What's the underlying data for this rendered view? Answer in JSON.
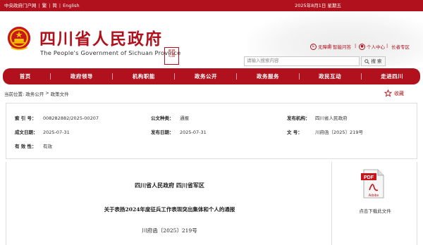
{
  "topbar": {
    "links": [
      "中央政府门户网",
      "繁",
      "简",
      "English"
    ],
    "date": "2025年8月1日 星期五"
  },
  "header": {
    "title": "四川省人民政府",
    "subtitle": "The People's Government of Sichuan Province",
    "seal_text": "天府之国",
    "quick_links": [
      "无障碍",
      "智能问答",
      "个人中心",
      "长者专区"
    ],
    "search_placeholder": "请输入搜索内容",
    "search_button": "搜 索"
  },
  "nav": [
    "首页",
    "政府领导",
    "机构职能",
    "政务公开",
    "政务服务",
    "政民互动",
    "走进四川"
  ],
  "breadcrumb": {
    "prefix": "当前位置:",
    "items": [
      "政务公开",
      "政策文件"
    ],
    "sep": ">"
  },
  "favorite": "收藏",
  "info": {
    "index_label": "索 引 号：",
    "index_value": "008282882/2025-00207",
    "type_label": "公文种类：",
    "type_value": "通报",
    "org_label": "发布机构：",
    "org_value": "四川省人民政府",
    "made_label": "成文日期：",
    "made_value": "2025-07-31",
    "pub_label": "发布日期：",
    "pub_value": "2025-07-31",
    "no_label": "文 号：",
    "no_value": "川府函〔2025〕219号",
    "valid_label": "有 效 性：",
    "valid_value": "有效"
  },
  "document": {
    "issuer": "四川省人民政府 四川省军区",
    "title": "关于表扬2024年度征兵工作表现突出集体和个人的通报",
    "number": "川府函〔2025〕219号"
  },
  "download": {
    "label": "点击下载此文件",
    "pdf_text": "PDF",
    "adobe_text": "Adobe"
  },
  "colors": {
    "brand_red": "#b0111c"
  }
}
